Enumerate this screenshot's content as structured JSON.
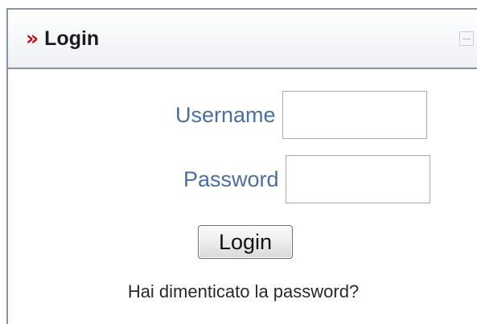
{
  "panel": {
    "title": "Login",
    "chevron_glyph": "»",
    "collapse_glyph": "−",
    "accent_color": "#c0101b"
  },
  "form": {
    "username_label": "Username",
    "username_value": "",
    "password_label": "Password",
    "password_value": "",
    "submit_label": "Login",
    "forgot_password_link": "Hai dimenticato la password?"
  },
  "icons": {
    "header_icon": "double-chevron-right-icon",
    "collapse_icon": "minus-icon"
  },
  "colors": {
    "label_color": "#4c6f9b",
    "border_color": "#8a94a0"
  }
}
